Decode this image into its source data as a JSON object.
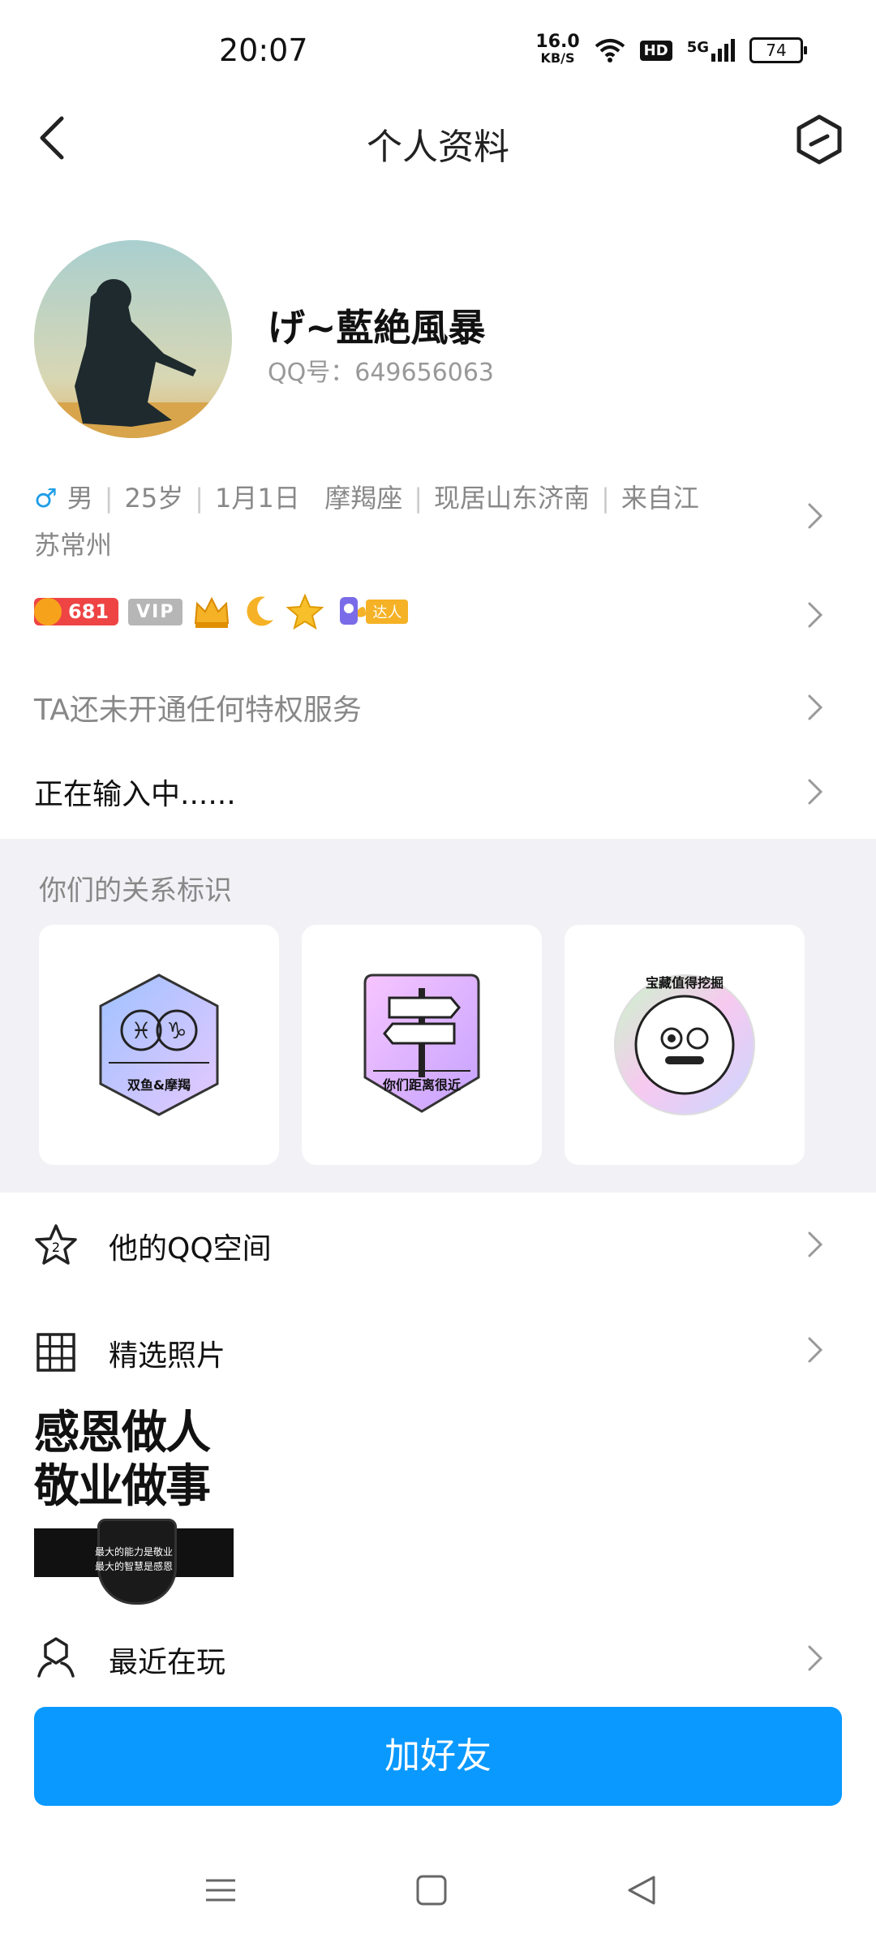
{
  "status_bar": {
    "time": "20:07",
    "speed_value": "16.0",
    "speed_unit": "KB/S",
    "hd": "HD",
    "network": "5G",
    "battery": "74"
  },
  "header": {
    "title": "个人资料"
  },
  "profile": {
    "nickname": "げ~藍絶風暴",
    "qq_number": "QQ号：649656063",
    "gender": "男",
    "age": "25岁",
    "birthday": "1月1日",
    "zodiac": "摩羯座",
    "location": "现居山东济南",
    "hometown_line1": "来自江",
    "hometown_line2": "苏常州",
    "level": "681",
    "vip": "VIP",
    "daren": "达人",
    "privilege": "TA还未开通任何特权服务",
    "signature": "正在输入中......"
  },
  "relations": {
    "title": "你们的关系标识",
    "cards": [
      {
        "label": "双鱼&摩羯"
      },
      {
        "label": "你们距离很近"
      },
      {
        "label": "宝藏值得挖掘"
      }
    ]
  },
  "rows": {
    "qzone": "他的QQ空间",
    "photos": "精选照片",
    "playing": "最近在玩"
  },
  "photo_card": {
    "line1": "感恩做人",
    "line2": "敬业做事",
    "small1": "最大的能力是敬业",
    "small2": "最大的智慧是感恩"
  },
  "action": {
    "add_friend": "加好友"
  },
  "colors": {
    "accent": "#0a99ff",
    "male": "#1e9ee6",
    "section_bg": "#f2f2f6"
  }
}
